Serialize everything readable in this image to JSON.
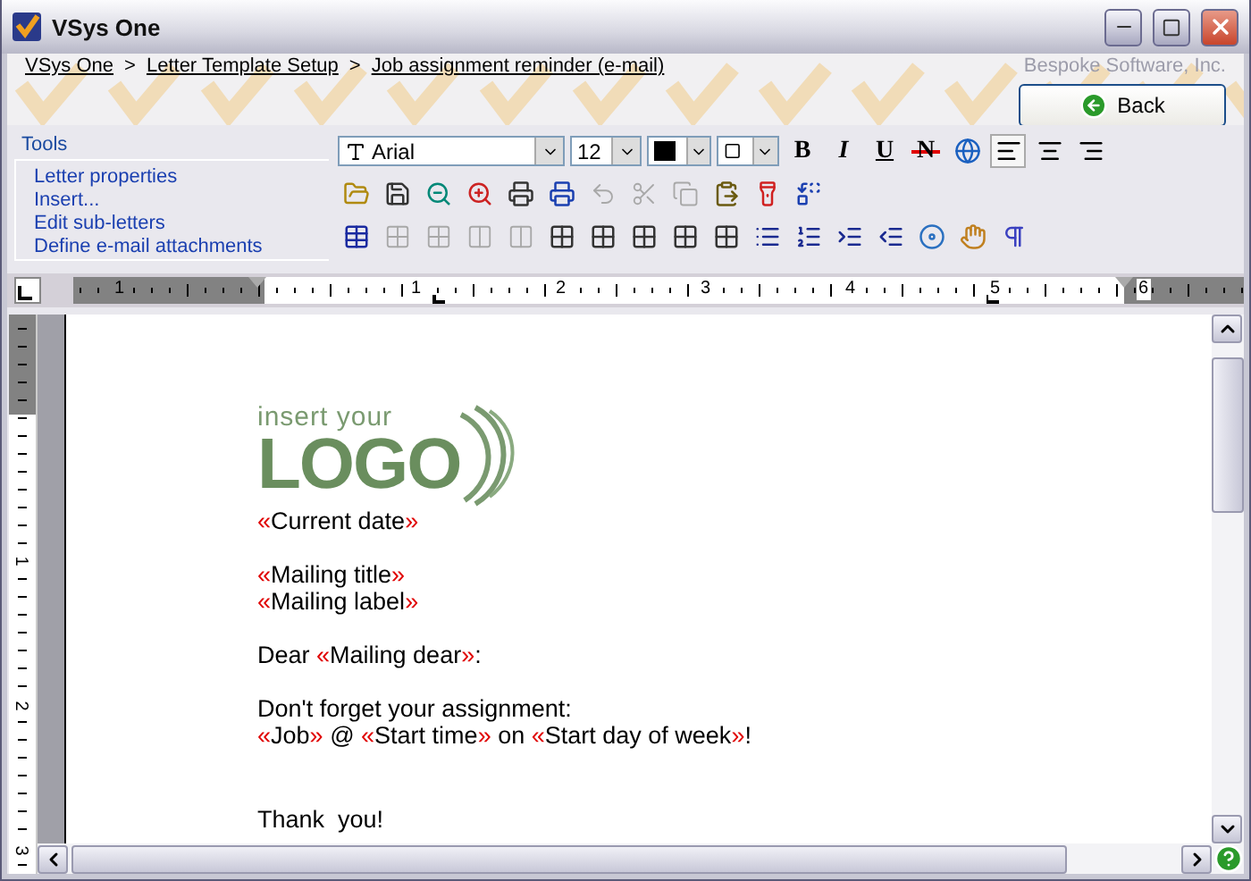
{
  "window": {
    "title": "VSys One"
  },
  "breadcrumb": [
    {
      "label": "VSys One"
    },
    {
      "label": "Letter Template Setup"
    },
    {
      "label": "Job assignment reminder (e-mail)"
    }
  ],
  "breadcrumb_separator": ">",
  "company": "Bespoke Software, Inc.",
  "back_button": "Back",
  "tools": {
    "title": "Tools",
    "items": [
      "Letter properties",
      "Insert...",
      "Edit sub-letters",
      "Define e-mail attachments"
    ]
  },
  "toolbar": {
    "font": "Arial",
    "size": "12",
    "format_buttons": [
      {
        "kind": "bold",
        "label": "B"
      },
      {
        "kind": "italic",
        "label": "I"
      },
      {
        "kind": "underline",
        "label": "U"
      },
      {
        "kind": "strike",
        "label": "N"
      }
    ],
    "align": [
      {
        "kind": "left",
        "selected": true
      },
      {
        "kind": "center",
        "selected": false
      },
      {
        "kind": "right",
        "selected": false
      }
    ],
    "row2": [
      {
        "kind": "open",
        "disabled": false
      },
      {
        "kind": "save",
        "disabled": false
      },
      {
        "kind": "zoom-out",
        "disabled": false
      },
      {
        "kind": "zoom-in",
        "disabled": false
      },
      {
        "kind": "print",
        "disabled": false
      },
      {
        "kind": "preview",
        "disabled": false
      },
      {
        "kind": "undo",
        "disabled": true
      },
      {
        "kind": "cut",
        "disabled": true
      },
      {
        "kind": "copy",
        "disabled": true
      },
      {
        "kind": "paste",
        "disabled": false
      },
      {
        "kind": "highlight",
        "disabled": false
      },
      {
        "kind": "replace",
        "disabled": false
      }
    ],
    "row3": [
      {
        "kind": "table",
        "disabled": false
      },
      {
        "kind": "grid",
        "disabled": true
      },
      {
        "kind": "grid",
        "disabled": true
      },
      {
        "kind": "columns",
        "disabled": true
      },
      {
        "kind": "columns",
        "disabled": true
      },
      {
        "kind": "grid",
        "disabled": false
      },
      {
        "kind": "grid",
        "disabled": false
      },
      {
        "kind": "grid",
        "disabled": false
      },
      {
        "kind": "grid",
        "disabled": false
      },
      {
        "kind": "grid",
        "disabled": false
      },
      {
        "kind": "bullets",
        "disabled": false
      },
      {
        "kind": "numbers",
        "disabled": false
      },
      {
        "kind": "indent",
        "disabled": false
      },
      {
        "kind": "outdent",
        "disabled": false
      },
      {
        "kind": "disc",
        "disabled": false
      },
      {
        "kind": "hand",
        "disabled": false
      },
      {
        "kind": "pilcrow",
        "disabled": false
      }
    ]
  },
  "ruler": {
    "labels": [
      "1",
      "1",
      "2",
      "3",
      "4",
      "5",
      "6"
    ],
    "vertical_labels": [
      "1",
      "2",
      "3"
    ]
  },
  "letter": {
    "logo": {
      "small": "insert your",
      "big": "LOGO"
    },
    "paragraphs": [
      {
        "lines": [
          [
            {
              "kind": "mark",
              "text": "«"
            },
            {
              "kind": "text",
              "text": "Current date"
            },
            {
              "kind": "mark",
              "text": "»"
            }
          ]
        ]
      },
      {
        "lines": [
          [
            {
              "kind": "mark",
              "text": "«"
            },
            {
              "kind": "text",
              "text": "Mailing title"
            },
            {
              "kind": "mark",
              "text": "»"
            }
          ],
          [
            {
              "kind": "mark",
              "text": "«"
            },
            {
              "kind": "text",
              "text": "Mailing label"
            },
            {
              "kind": "mark",
              "text": "»"
            }
          ]
        ]
      },
      {
        "lines": [
          [
            {
              "kind": "text",
              "text": "Dear "
            },
            {
              "kind": "mark",
              "text": "«"
            },
            {
              "kind": "text",
              "text": "Mailing dear"
            },
            {
              "kind": "mark",
              "text": "»"
            },
            {
              "kind": "text",
              "text": ":"
            }
          ]
        ]
      },
      {
        "lines": [
          [
            {
              "kind": "text",
              "text": "Don't forget your assignment:"
            }
          ],
          [
            {
              "kind": "mark",
              "text": "«"
            },
            {
              "kind": "text",
              "text": "Job"
            },
            {
              "kind": "mark",
              "text": "»"
            },
            {
              "kind": "text",
              "text": " @ "
            },
            {
              "kind": "mark",
              "text": "«"
            },
            {
              "kind": "text",
              "text": "Start time"
            },
            {
              "kind": "mark",
              "text": "»"
            },
            {
              "kind": "text",
              "text": " on "
            },
            {
              "kind": "mark",
              "text": "«"
            },
            {
              "kind": "text",
              "text": "Start day of week"
            },
            {
              "kind": "mark",
              "text": "»"
            },
            {
              "kind": "text",
              "text": "!"
            }
          ]
        ]
      },
      {
        "lines": [
          [
            {
              "kind": "text",
              "text": "Thank  you!"
            }
          ]
        ]
      }
    ]
  }
}
